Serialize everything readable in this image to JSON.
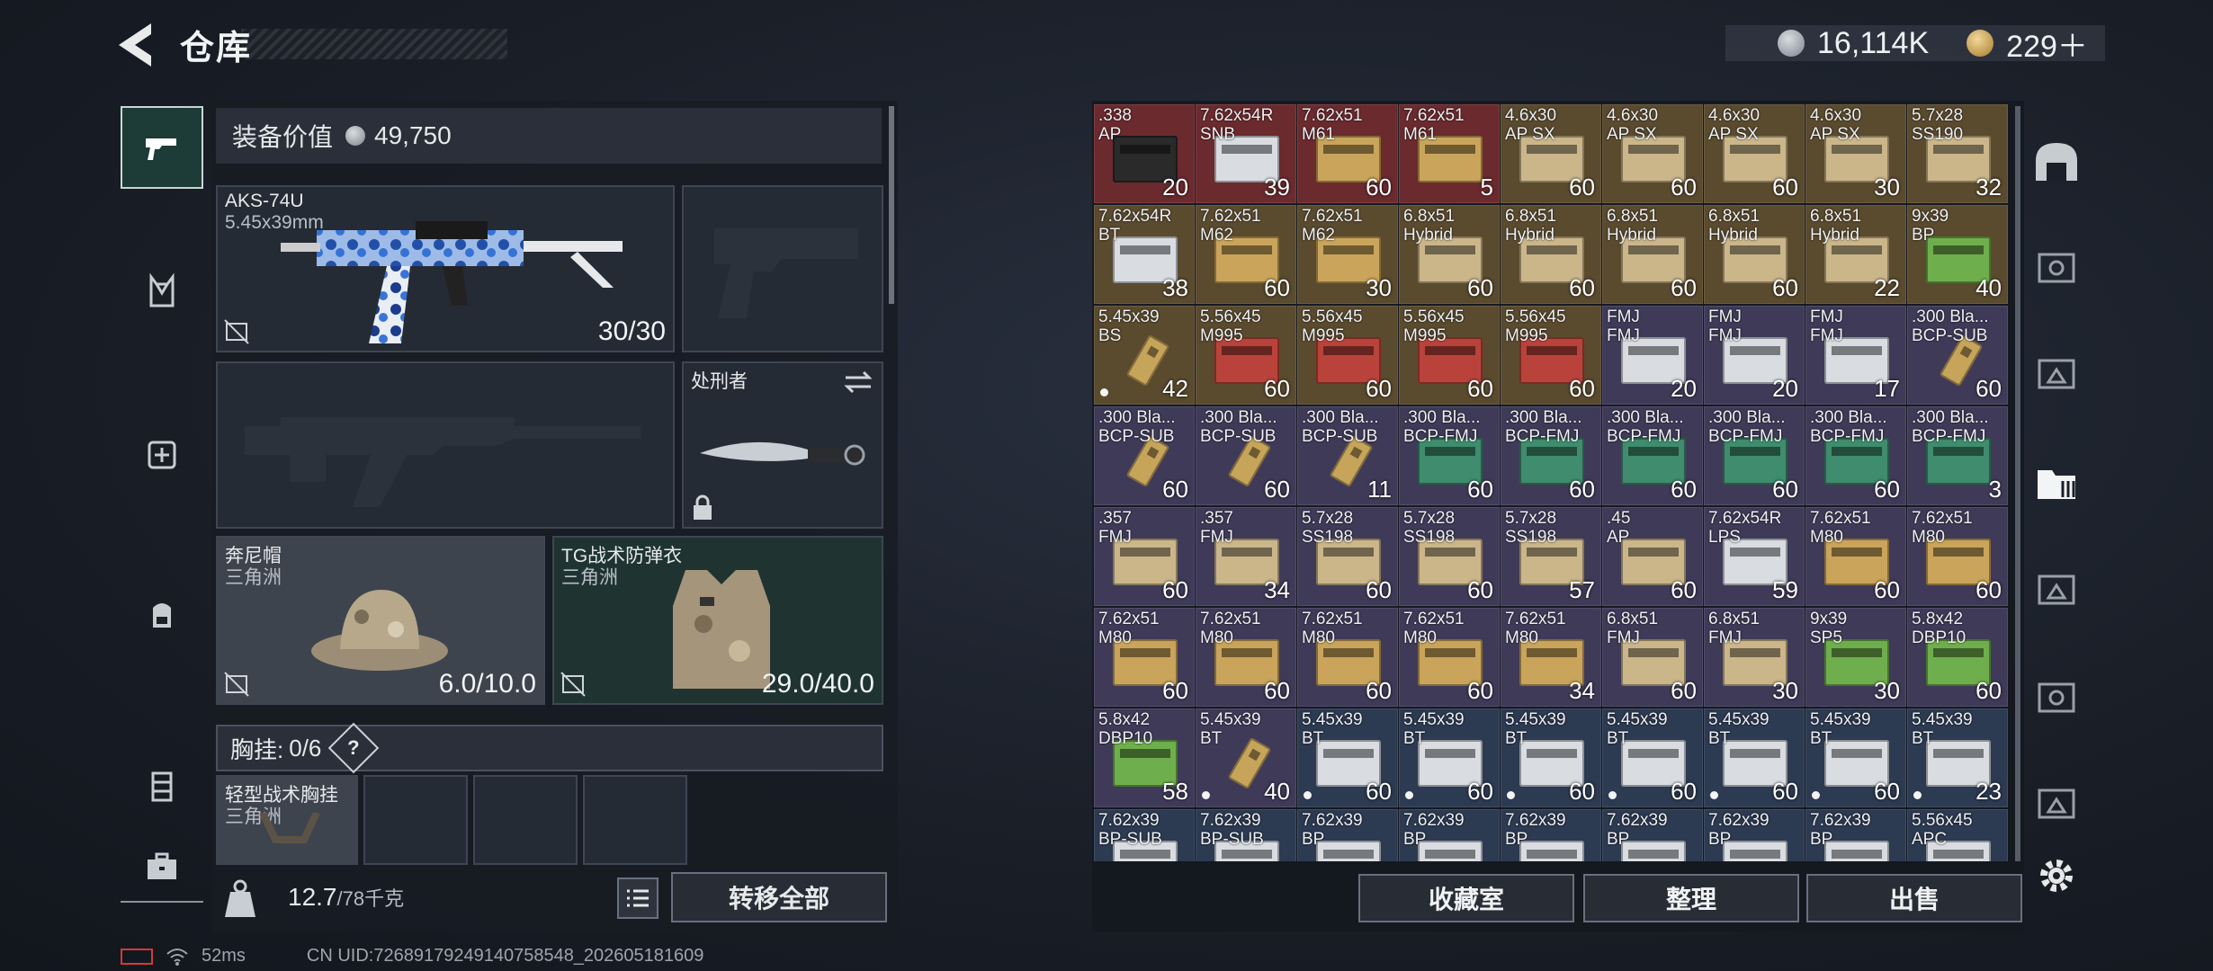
{
  "header": {
    "title": "仓库",
    "currencies": [
      {
        "icon": "silver-coin-icon",
        "value": "16,114K"
      },
      {
        "icon": "gold-coin-icon",
        "value": "229＋"
      }
    ]
  },
  "loadout": {
    "value_label": "装备价值",
    "value": "49,750",
    "primary": {
      "name": "AKS-74U",
      "caliber": "5.45x39mm",
      "ammo": "30/30"
    },
    "melee": {
      "name": "处刑者"
    },
    "helmet": {
      "name": "奔尼帽",
      "faction": "三角洲",
      "durability": "6.0/10.0"
    },
    "armor": {
      "name": "TG战术防弹衣",
      "faction": "三角洲",
      "durability": "29.0/40.0"
    },
    "chest": {
      "label": "胸挂:",
      "count": "0/6",
      "help": "?"
    },
    "chest_item": {
      "name": "轻型战术胸挂",
      "faction": "三角洲"
    },
    "weight": "12.7",
    "weight_max": "/78千克",
    "transfer_all": "转移全部"
  },
  "actions": {
    "collection": "收藏室",
    "sort": "整理",
    "sell": "出售"
  },
  "footer": {
    "ping": "52ms",
    "uid": "CN UID:72689179249140758548_202605181609"
  },
  "colors": {
    "accent_green": "#1d3b37",
    "red_tier": "#6b2a2e",
    "gold_tier": "#5a4a2e",
    "purple_tier": "#3f3a58",
    "blue_tier": "#2c3a52"
  },
  "ammo": [
    {
      "cal": ".338",
      "sub": "AP",
      "qty": "20",
      "tier": "red",
      "box": "dark"
    },
    {
      "cal": "7.62x54R",
      "sub": "SNB",
      "qty": "39",
      "tier": "red",
      "box": "white"
    },
    {
      "cal": "7.62x51",
      "sub": "M61",
      "qty": "60",
      "tier": "red",
      "box": "tan"
    },
    {
      "cal": "7.62x51",
      "sub": "M61",
      "qty": "5",
      "tier": "red",
      "box": "tan"
    },
    {
      "cal": "4.6x30",
      "sub": "AP SX",
      "qty": "60",
      "tier": "gold",
      "box": "beige"
    },
    {
      "cal": "4.6x30",
      "sub": "AP SX",
      "qty": "60",
      "tier": "gold",
      "box": "beige"
    },
    {
      "cal": "4.6x30",
      "sub": "AP SX",
      "qty": "60",
      "tier": "gold",
      "box": "beige"
    },
    {
      "cal": "4.6x30",
      "sub": "AP SX",
      "qty": "30",
      "tier": "gold",
      "box": "beige"
    },
    {
      "cal": "5.7x28",
      "sub": "SS190",
      "qty": "32",
      "tier": "gold",
      "box": "beige"
    },
    {
      "cal": "7.62x54R",
      "sub": "BT",
      "qty": "38",
      "tier": "gold",
      "box": "white"
    },
    {
      "cal": "7.62x51",
      "sub": "M62",
      "qty": "60",
      "tier": "gold",
      "box": "tan"
    },
    {
      "cal": "7.62x51",
      "sub": "M62",
      "qty": "30",
      "tier": "gold",
      "box": "tan"
    },
    {
      "cal": "6.8x51",
      "sub": "Hybrid",
      "qty": "60",
      "tier": "gold",
      "box": "beige"
    },
    {
      "cal": "6.8x51",
      "sub": "Hybrid",
      "qty": "60",
      "tier": "gold",
      "box": "beige"
    },
    {
      "cal": "6.8x51",
      "sub": "Hybrid",
      "qty": "60",
      "tier": "gold",
      "box": "beige"
    },
    {
      "cal": "6.8x51",
      "sub": "Hybrid",
      "qty": "60",
      "tier": "gold",
      "box": "beige"
    },
    {
      "cal": "6.8x51",
      "sub": "Hybrid",
      "qty": "22",
      "tier": "gold",
      "box": "beige"
    },
    {
      "cal": "9x39",
      "sub": "BP",
      "qty": "40",
      "tier": "gold",
      "box": "green"
    },
    {
      "cal": "5.45x39",
      "sub": "BS",
      "qty": "42",
      "tier": "gold",
      "box": "bullet",
      "dot": true
    },
    {
      "cal": "5.56x45",
      "sub": "M995",
      "qty": "60",
      "tier": "gold",
      "box": "red"
    },
    {
      "cal": "5.56x45",
      "sub": "M995",
      "qty": "60",
      "tier": "gold",
      "box": "red"
    },
    {
      "cal": "5.56x45",
      "sub": "M995",
      "qty": "60",
      "tier": "gold",
      "box": "red"
    },
    {
      "cal": "5.56x45",
      "sub": "M995",
      "qty": "60",
      "tier": "gold",
      "box": "red"
    },
    {
      "cal": "FMJ",
      "sub": "FMJ",
      "qty": "20",
      "tier": "purple",
      "box": "white"
    },
    {
      "cal": "FMJ",
      "sub": "FMJ",
      "qty": "20",
      "tier": "purple",
      "box": "white"
    },
    {
      "cal": "FMJ",
      "sub": "FMJ",
      "qty": "17",
      "tier": "purple",
      "box": "white"
    },
    {
      "cal": ".300 Bla...",
      "sub": "BCP-SUB",
      "qty": "60",
      "tier": "purple",
      "box": "bullet"
    },
    {
      "cal": ".300 Bla...",
      "sub": "BCP-SUB",
      "qty": "60",
      "tier": "purple",
      "box": "bullet"
    },
    {
      "cal": ".300 Bla...",
      "sub": "BCP-SUB",
      "qty": "60",
      "tier": "purple",
      "box": "bullet"
    },
    {
      "cal": ".300 Bla...",
      "sub": "BCP-SUB",
      "qty": "11",
      "tier": "purple",
      "box": "bullet"
    },
    {
      "cal": ".300 Bla...",
      "sub": "BCP-FMJ",
      "qty": "60",
      "tier": "purple",
      "box": "teal"
    },
    {
      "cal": ".300 Bla...",
      "sub": "BCP-FMJ",
      "qty": "60",
      "tier": "purple",
      "box": "teal"
    },
    {
      "cal": ".300 Bla...",
      "sub": "BCP-FMJ",
      "qty": "60",
      "tier": "purple",
      "box": "teal"
    },
    {
      "cal": ".300 Bla...",
      "sub": "BCP-FMJ",
      "qty": "60",
      "tier": "purple",
      "box": "teal"
    },
    {
      "cal": ".300 Bla...",
      "sub": "BCP-FMJ",
      "qty": "60",
      "tier": "purple",
      "box": "teal"
    },
    {
      "cal": ".300 Bla...",
      "sub": "BCP-FMJ",
      "qty": "3",
      "tier": "purple",
      "box": "teal"
    },
    {
      "cal": ".357",
      "sub": "FMJ",
      "qty": "60",
      "tier": "purple",
      "box": "beige"
    },
    {
      "cal": ".357",
      "sub": "FMJ",
      "qty": "34",
      "tier": "purple",
      "box": "beige"
    },
    {
      "cal": "5.7x28",
      "sub": "SS198",
      "qty": "60",
      "tier": "purple",
      "box": "beige"
    },
    {
      "cal": "5.7x28",
      "sub": "SS198",
      "qty": "60",
      "tier": "purple",
      "box": "beige"
    },
    {
      "cal": "5.7x28",
      "sub": "SS198",
      "qty": "57",
      "tier": "purple",
      "box": "beige"
    },
    {
      "cal": ".45",
      "sub": "AP",
      "qty": "60",
      "tier": "purple",
      "box": "beige"
    },
    {
      "cal": "7.62x54R",
      "sub": "LPS",
      "qty": "59",
      "tier": "purple",
      "box": "white"
    },
    {
      "cal": "7.62x51",
      "sub": "M80",
      "qty": "60",
      "tier": "purple",
      "box": "tan"
    },
    {
      "cal": "7.62x51",
      "sub": "M80",
      "qty": "60",
      "tier": "purple",
      "box": "tan"
    },
    {
      "cal": "7.62x51",
      "sub": "M80",
      "qty": "60",
      "tier": "purple",
      "box": "tan"
    },
    {
      "cal": "7.62x51",
      "sub": "M80",
      "qty": "60",
      "tier": "purple",
      "box": "tan"
    },
    {
      "cal": "7.62x51",
      "sub": "M80",
      "qty": "60",
      "tier": "purple",
      "box": "tan"
    },
    {
      "cal": "7.62x51",
      "sub": "M80",
      "qty": "60",
      "tier": "purple",
      "box": "tan"
    },
    {
      "cal": "7.62x51",
      "sub": "M80",
      "qty": "34",
      "tier": "purple",
      "box": "tan"
    },
    {
      "cal": "6.8x51",
      "sub": "FMJ",
      "qty": "60",
      "tier": "purple",
      "box": "beige"
    },
    {
      "cal": "6.8x51",
      "sub": "FMJ",
      "qty": "30",
      "tier": "purple",
      "box": "beige"
    },
    {
      "cal": "9x39",
      "sub": "SP5",
      "qty": "30",
      "tier": "purple",
      "box": "green"
    },
    {
      "cal": "5.8x42",
      "sub": "DBP10",
      "qty": "60",
      "tier": "purple",
      "box": "green"
    },
    {
      "cal": "5.8x42",
      "sub": "DBP10",
      "qty": "58",
      "tier": "purple",
      "box": "green"
    },
    {
      "cal": "5.45x39",
      "sub": "BT",
      "qty": "40",
      "tier": "purple",
      "box": "bullet",
      "dot": true
    },
    {
      "cal": "5.45x39",
      "sub": "BT",
      "qty": "60",
      "tier": "blue",
      "box": "white",
      "dot": true
    },
    {
      "cal": "5.45x39",
      "sub": "BT",
      "qty": "60",
      "tier": "blue",
      "box": "white",
      "dot": true
    },
    {
      "cal": "5.45x39",
      "sub": "BT",
      "qty": "60",
      "tier": "blue",
      "box": "white",
      "dot": true
    },
    {
      "cal": "5.45x39",
      "sub": "BT",
      "qty": "60",
      "tier": "blue",
      "box": "white",
      "dot": true
    },
    {
      "cal": "5.45x39",
      "sub": "BT",
      "qty": "60",
      "tier": "blue",
      "box": "white",
      "dot": true
    },
    {
      "cal": "5.45x39",
      "sub": "BT",
      "qty": "60",
      "tier": "blue",
      "box": "white",
      "dot": true
    },
    {
      "cal": "5.45x39",
      "sub": "BT",
      "qty": "23",
      "tier": "blue",
      "box": "white",
      "dot": true
    },
    {
      "cal": "7.62x39",
      "sub": "BP-SUB",
      "qty": "",
      "tier": "blue",
      "box": "white"
    },
    {
      "cal": "7.62x39",
      "sub": "BP-SUB",
      "qty": "",
      "tier": "blue",
      "box": "white"
    },
    {
      "cal": "7.62x39",
      "sub": "BP",
      "qty": "",
      "tier": "blue",
      "box": "white"
    },
    {
      "cal": "7.62x39",
      "sub": "BP",
      "qty": "",
      "tier": "blue",
      "box": "white"
    },
    {
      "cal": "7.62x39",
      "sub": "BP",
      "qty": "",
      "tier": "blue",
      "box": "white"
    },
    {
      "cal": "7.62x39",
      "sub": "BP",
      "qty": "",
      "tier": "blue",
      "box": "white"
    },
    {
      "cal": "7.62x39",
      "sub": "BP",
      "qty": "",
      "tier": "blue",
      "box": "white"
    },
    {
      "cal": "7.62x39",
      "sub": "BP",
      "qty": "",
      "tier": "blue",
      "box": "white"
    },
    {
      "cal": "5.56x45",
      "sub": "APC",
      "qty": "",
      "tier": "blue",
      "box": "white",
      "dot": true
    }
  ]
}
